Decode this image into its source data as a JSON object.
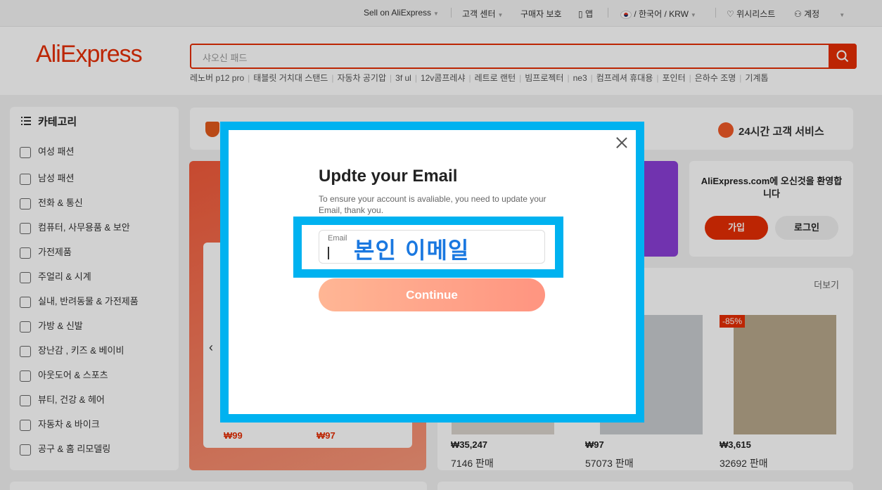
{
  "topbar": {
    "sell": "Sell on AliExpress",
    "customer_center": "고객 센터",
    "buyer_protection": "구매자 보호",
    "app": "앱",
    "locale": "/ 한국어 / KRW",
    "wishlist": "위시리스트",
    "account": "계정"
  },
  "header": {
    "logo": "AliExpress",
    "search_placeholder": "샤오신 패드",
    "hot_words": [
      "레노버 p12 pro",
      "태블릿 거치대 스탠드",
      "자동차 공기압",
      "3f ul",
      "12v콤프레샤",
      "레트로 랜턴",
      "빔프로젝터",
      "ne3",
      "컴프레셔 휴대용",
      "포인터",
      "은하수 조명",
      "기계톱"
    ]
  },
  "categories": {
    "title": "카테고리",
    "items": [
      "여성 패션",
      "남성 패션",
      "전화 & 통신",
      "컴퓨터, 사무용품 & 보안",
      "가전제품",
      "주얼리 & 시계",
      "실내, 반려동물 & 가전제품",
      "가방 & 신발",
      "장난감 , 키즈 & 베이비",
      "아웃도어 & 스포츠",
      "뷰티, 건강 & 헤어",
      "자동차 & 바이크",
      "공구 & 홈 리모델링"
    ]
  },
  "service": {
    "cs_label": "24시간 고객 서비스"
  },
  "hero": {
    "price_a": "₩99",
    "price_b": "₩97"
  },
  "welcome": {
    "text": "AliExpress.com에 오신것을 환영합니다",
    "join": "가입",
    "login": "로그인"
  },
  "products": {
    "more": "더보기",
    "discount": "-85%",
    "items": [
      {
        "price": "₩35,247",
        "sold": "7146 판매"
      },
      {
        "price": "₩97",
        "sold": "57073 판매"
      },
      {
        "price": "₩3,615",
        "sold": "32692 판매"
      }
    ]
  },
  "modal": {
    "title": "Updte your Email",
    "description": "To ensure your account is avaliable, you need to update your Email, thank you.",
    "email_label": "Email",
    "email_annotation": "본인 이메일",
    "continue": "Continue"
  },
  "colors": {
    "brand": "#e62e04",
    "annotation_frame": "#00b2f0",
    "annotation_text": "#1a78e0"
  }
}
